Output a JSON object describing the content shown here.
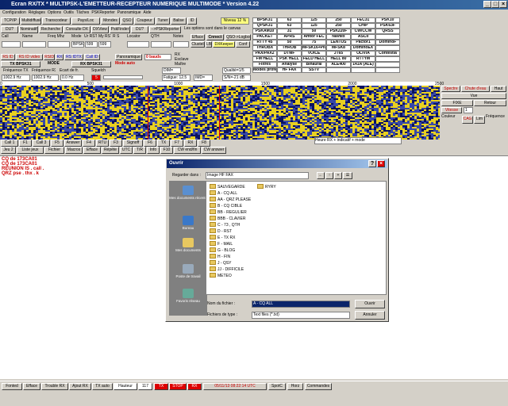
{
  "title": "Ecran RX/TX  * MULTIPSK-L'EMETTEUR-RECEPTEUR NUMERIQUE MULTIMODE * Version 4.22",
  "menu": [
    "Configuration",
    "Réglages",
    "Options",
    "Outils",
    "Tâches",
    "PSKReporter",
    "Panoramique",
    "Aide"
  ],
  "toolbar": {
    "row1": [
      "TCP/IP",
      "Multidiffusion",
      "Transcodeur",
      "Pays/Loc",
      "Mondes",
      "QSO",
      "Coupeur",
      "Tuner",
      "Balise",
      "ID"
    ],
    "niveau": "Niveau 12 %",
    "row2": [
      "DU?",
      "Nominatif",
      "Recherche",
      "Consulte DX",
      "DXView",
      "PskFinder",
      "DU?",
      "-->PSKReporter"
    ],
    "canvas_hint": "Les options sont dans le canvas",
    "headers": [
      "Call",
      "Name",
      "Freq Mhz",
      "Mode",
      "Ur RST",
      "My RST",
      "R S",
      "Locator",
      "QTH",
      "Notes",
      "Efface",
      "Cnnect"
    ],
    "fields": {
      "mode": "BPSK",
      "my_rst": "599",
      "ur_rst": "599"
    },
    "qsl_text": "QSO->Logbook",
    "clustel": "Clustel",
    "lb": "LB",
    "dx_keeper": "DXKeeper",
    "conf": "Conf",
    "call_id": "Call ID",
    "call_bits": [
      "RS ID",
      "RS ID video",
      "RSID",
      "RX",
      "RS IDTX",
      "Call ID"
    ],
    "panoramique": "Panoramique",
    "baud": "0 bauds",
    "mode_tx": "TX BPSK31",
    "mode_rx": "RX BPSK31",
    "mode_lbl": "MODE",
    "freq_labels": [
      "Fréquence TX",
      "Fréquence RX",
      "Ecart de fr.",
      "Squelch"
    ],
    "freq_values": [
      "1002.9 Hz",
      "1002.9 Hz",
      "0.0 Hz"
    ],
    "squelch_val": "5",
    "mode_auto": "Mode auto",
    "dim": "DIM=",
    "qual": "Qualité=1/5",
    "imd": "IMD=",
    "snr": "S/N=-21 dB",
    "radio": [
      "RX",
      "Esclave",
      "Maître"
    ],
    "fatigue": "Fatigue: 12.5"
  },
  "modes": [
    "BPSK31",
    "63",
    "125",
    "250",
    "FEC31",
    "PSK10",
    "MT63",
    "",
    "QPSK31",
    "63",
    "125",
    "250",
    "CHIP",
    "PSK63F",
    "DIGISSTV",
    "",
    "PSKAM10",
    "31",
    "50",
    "PSK220F",
    "CW/CCW",
    "QRSS",
    "",
    "",
    "PACKET",
    "APRS",
    "Amtor FEC",
    "Navtex",
    "ASCII",
    "",
    "",
    "",
    "RTTY 45",
    "50",
    "75",
    "LENTUS",
    "Pactor1",
    "DominoF",
    "",
    "",
    "THROBX",
    "THROB",
    "MFSK16+PIC",
    "MFSK8",
    "DominoEX",
    "",
    "",
    "",
    "PAX/PAX2",
    "DTMF",
    "VOICE",
    "JT65",
    "OLIVIA",
    "Contestia",
    "",
    "",
    "FM HELL",
    "PSK HELL",
    "FELD HELL",
    "HELL 80",
    "RTTYM",
    "",
    "",
    "",
    "Filtres",
    "Analyse",
    "Binaural",
    "ALE400",
    "141A (ALE)",
    "",
    "",
    "",
    "Modes professionnels",
    "HF FAX",
    "SSTV",
    "",
    "",
    "",
    "",
    ""
  ],
  "right_panel": {
    "spectre": "Spectre",
    "chute": "Chute d'eau",
    "haut": "Haut",
    "vue": "Vue",
    "fixe": "FIXE",
    "retour": "Retour",
    "vitesse": "Vitesse",
    "vitesse_val": "1",
    "couleur": "Couleur",
    "cag": "CAG",
    "lim": "Lim",
    "frequence": "Fréquence",
    "buttons": [
      "MM",
      "H1",
      "V1",
      "H1",
      "V1",
      "H1",
      "V1",
      "<<",
      ">>",
      ">>"
    ],
    "num": [
      "10",
      "2.5",
      "2.5"
    ]
  },
  "scale": [
    "0",
    "500",
    "1000",
    "1500",
    "2000",
    "2500"
  ],
  "macros": {
    "row1": [
      "Call 1",
      "F1",
      "Call 3",
      "F5",
      "Answer",
      "F4",
      "RTU",
      "F3",
      "Signoff",
      "F6",
      "TX",
      "F7",
      "RX",
      "F8"
    ],
    "row2": [
      "Jeu 2",
      "Liste jeux",
      "Fichier",
      "Macros",
      "Efface",
      "Répète",
      "UTC",
      "T/R",
      "Info",
      "F10",
      "CW end/fin",
      "CW answer"
    ],
    "heure": "Heure RX + indicatif + mode"
  },
  "rx_lines": [
    "CQ de 173CA01",
    "CQ de 173CA01",
    "REUNION IS . call .",
    "QRZ pse . thx . k"
  ],
  "dialog": {
    "title": "Ouvrir",
    "look_in_label": "Regarder dans :",
    "look_in_value": "Image HF FAX",
    "places": [
      "Mes documents récents",
      "Bureau",
      "Mes documents",
      "Poste de travail",
      "Favoris réseau"
    ],
    "files_col1": [
      "SAUVEGARDE",
      "A - CQ ALL",
      "AA - QRZ PLEASE",
      "B - CQ CIBLE",
      "BB - REGULIER",
      "BBB - CLAVIER",
      "C - 73 , QTH",
      "D - RST",
      "E - TX RX",
      "F - MAIL",
      "G - BLOG",
      "H - FIN",
      "J - QSY",
      "JJ - DIFFICILE",
      "METEO"
    ],
    "files_col2": [
      "RYRY"
    ],
    "filename_label": "Nom du fichier :",
    "filename_value": "A - CQ ALL",
    "filetype_label": "Fichiers de type :",
    "filetype_value": "Text files (*.txt)",
    "open_btn": "Ouvrir",
    "cancel_btn": "Annuler"
  },
  "status": {
    "items": [
      "Fonted",
      "Efface",
      "Trouble RX",
      "Ajout RX",
      "TX auto",
      "Hauteur",
      "117",
      "TX",
      "STOP",
      "RX"
    ],
    "datetime": "05/11/13 08:22:14 UTC",
    "spot": "SpotC",
    "horz": "Horz",
    "commandes": "Commandes"
  }
}
